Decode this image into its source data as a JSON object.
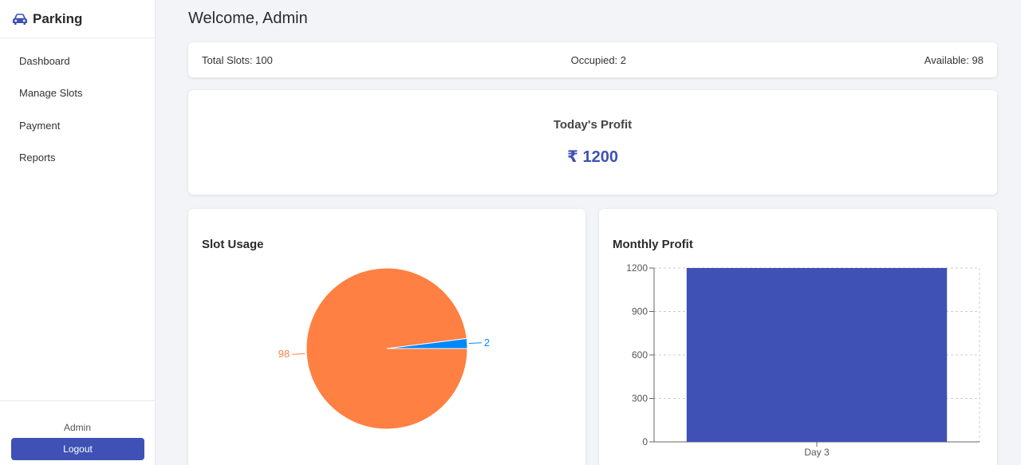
{
  "brand": {
    "title": "Parking",
    "icon": "car-icon"
  },
  "sidebar": {
    "items": [
      {
        "label": "Dashboard"
      },
      {
        "label": "Manage Slots"
      },
      {
        "label": "Payment"
      },
      {
        "label": "Reports"
      }
    ],
    "user": "Admin",
    "logout_label": "Logout"
  },
  "header": {
    "welcome": "Welcome, Admin"
  },
  "stats": {
    "total": "Total Slots: 100",
    "occupied": "Occupied: 2",
    "available": "Available: 98"
  },
  "profit": {
    "title": "Today's Profit",
    "value": "₹ 1200"
  },
  "colors": {
    "accent": "#3f51b5",
    "available": "#ff8042",
    "occupied": "#0088fe"
  },
  "charts": {
    "usage_title": "Slot Usage",
    "monthly_title": "Monthly Profit"
  },
  "chart_data": [
    {
      "type": "pie",
      "title": "Slot Usage",
      "labels": [
        "98",
        "2"
      ],
      "values": [
        98,
        2
      ],
      "colors": [
        "#ff8042",
        "#0088fe"
      ]
    },
    {
      "type": "bar",
      "title": "Monthly Profit",
      "categories": [
        "Day 3"
      ],
      "values": [
        1200
      ],
      "ylim": [
        0,
        1200
      ],
      "yticks": [
        0,
        300,
        600,
        900,
        1200
      ],
      "grid": true,
      "color": "#3f51b5"
    }
  ]
}
